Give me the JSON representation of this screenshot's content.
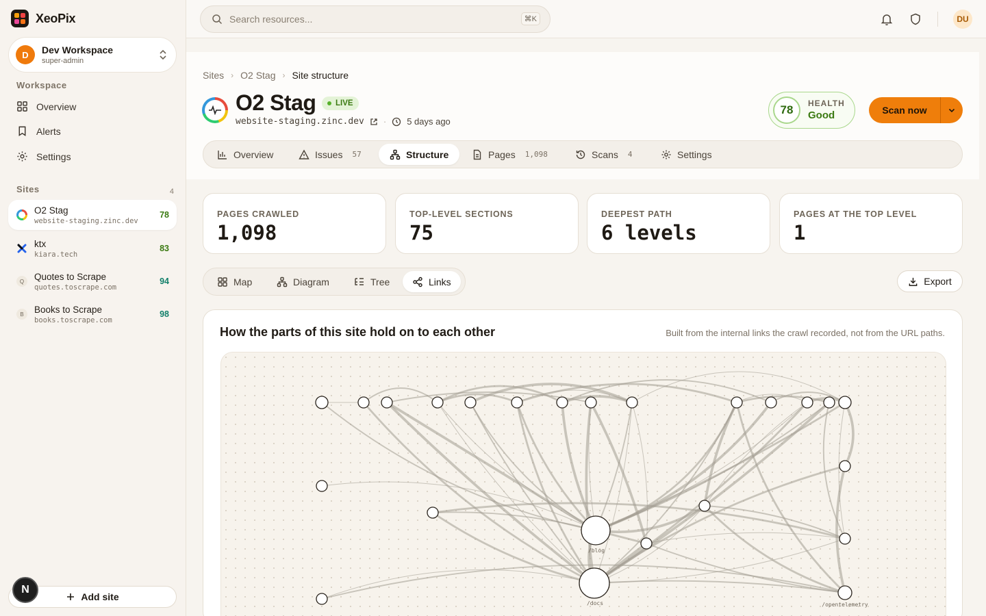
{
  "app": {
    "name": "XeoPix"
  },
  "workspace": {
    "name": "Dev Workspace",
    "role": "super-admin",
    "initial": "D"
  },
  "sidebar": {
    "section_workspace": "Workspace",
    "nav": [
      {
        "label": "Overview",
        "icon": "grid-icon"
      },
      {
        "label": "Alerts",
        "icon": "bookmark-icon"
      },
      {
        "label": "Settings",
        "icon": "gear-icon"
      }
    ],
    "section_sites": "Sites",
    "sites_count": "4",
    "sites": [
      {
        "name": "O2 Stag",
        "url": "website-staging.zinc.dev",
        "score": "78",
        "score_color": "#3b7a12",
        "active": true
      },
      {
        "name": "ktx",
        "url": "kiara.tech",
        "score": "83",
        "score_color": "#3b7a12"
      },
      {
        "name": "Quotes to Scrape",
        "url": "quotes.toscrape.com",
        "score": "94",
        "score_color": "#13806b",
        "initial": "Q"
      },
      {
        "name": "Books to Scrape",
        "url": "books.toscrape.com",
        "score": "98",
        "score_color": "#13806b",
        "initial": "B"
      }
    ],
    "add_site": "Add site",
    "n_badge": "N"
  },
  "topbar": {
    "search_placeholder": "Search resources...",
    "shortcut": "⌘K",
    "user_initials": "DU"
  },
  "breadcrumb": [
    "Sites",
    "O2 Stag",
    "Site structure"
  ],
  "site": {
    "title": "O2 Stag",
    "status": "LIVE",
    "domain": "website-staging.zinc.dev",
    "last_scan": "5 days ago"
  },
  "health": {
    "score": "78",
    "label": "HEALTH",
    "value": "Good"
  },
  "scan_button": "Scan now",
  "tabs": [
    {
      "label": "Overview",
      "count": "",
      "icon": "bar-chart-icon"
    },
    {
      "label": "Issues",
      "count": "57",
      "icon": "warning-icon"
    },
    {
      "label": "Structure",
      "count": "",
      "icon": "sitemap-icon",
      "active": true
    },
    {
      "label": "Pages",
      "count": "1,098",
      "icon": "document-icon"
    },
    {
      "label": "Scans",
      "count": "4",
      "icon": "history-icon"
    },
    {
      "label": "Settings",
      "count": "",
      "icon": "gear-icon"
    }
  ],
  "stats": [
    {
      "label": "PAGES CRAWLED",
      "value": "1,098"
    },
    {
      "label": "TOP-LEVEL SECTIONS",
      "value": "75"
    },
    {
      "label": "DEEPEST PATH",
      "value": "6 levels"
    },
    {
      "label": "PAGES AT THE TOP LEVEL",
      "value": "1"
    }
  ],
  "views": [
    {
      "label": "Map",
      "icon": "grid-icon"
    },
    {
      "label": "Diagram",
      "icon": "diagram-icon"
    },
    {
      "label": "Tree",
      "icon": "tree-icon"
    },
    {
      "label": "Links",
      "icon": "share-icon",
      "active": true
    }
  ],
  "export_label": "Export",
  "graph": {
    "title": "How the parts of this site hold on to each other",
    "note": "Built from the internal links the crawl recorded, not from the URL paths.",
    "labels": {
      "blog": "/blog",
      "docs": "/docs",
      "otel": "/opentelemetry"
    }
  }
}
